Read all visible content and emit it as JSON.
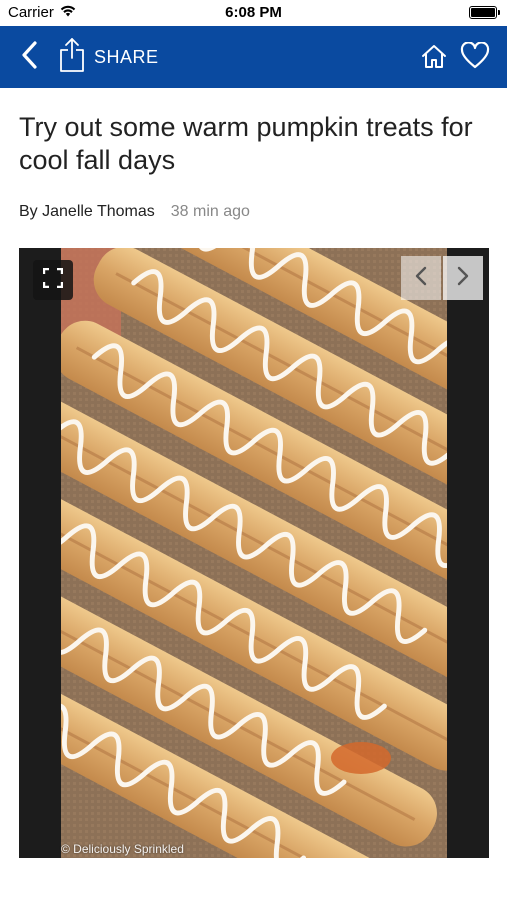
{
  "status_bar": {
    "carrier": "Carrier",
    "time": "6:08 PM",
    "battery_level": 1.0,
    "icons": [
      "wifi-icon",
      "battery-icon"
    ]
  },
  "nav_bar": {
    "background": "#0a4aa0",
    "share_label": "SHARE",
    "icons": [
      "back-chevron-icon",
      "share-icon",
      "home-icon",
      "heart-icon"
    ]
  },
  "article": {
    "title": "Try out some warm pumpkin treats for cool fall days",
    "author": "By Janelle Thomas",
    "time_ago": "38 min ago"
  },
  "gallery": {
    "photo_credit": "© Deliciously Sprinkled",
    "icons": [
      "fullscreen-icon",
      "chevron-left-icon",
      "chevron-right-icon"
    ]
  }
}
